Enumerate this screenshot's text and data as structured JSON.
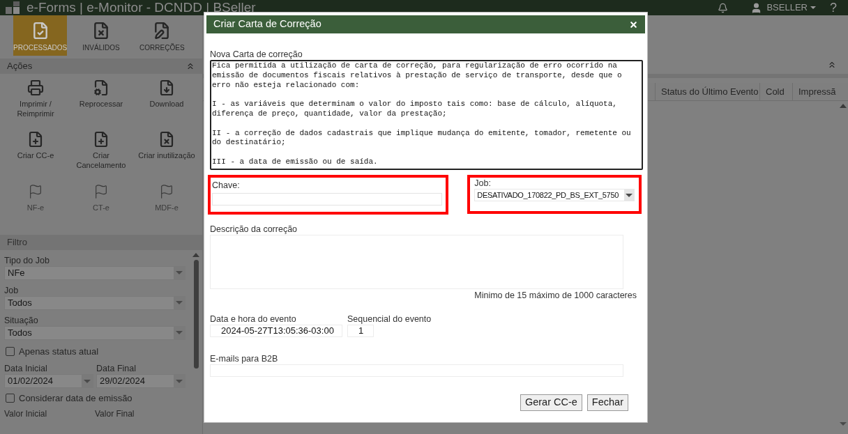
{
  "header": {
    "title": "e-Forms | e-Monitor - DCNDD | BSeller",
    "user": "BSELLER",
    "help": "?"
  },
  "tabs": [
    {
      "label": "PROCESSADOS",
      "kind": "processed",
      "selected": true
    },
    {
      "label": "INVÁLIDOS",
      "kind": "invalid",
      "selected": false
    },
    {
      "label": "CORREÇÕES",
      "kind": "correction",
      "selected": false
    }
  ],
  "actions": {
    "title": "Ações",
    "items": [
      {
        "label": "Imprimir / Reimprimir",
        "kind": "print"
      },
      {
        "label": "Reprocessar",
        "kind": "reprocess"
      },
      {
        "label": "Download",
        "kind": "download"
      },
      {
        "label": "Criar CC-e",
        "kind": "create"
      },
      {
        "label": "Criar Cancelamento",
        "kind": "create"
      },
      {
        "label": "Criar inutilização",
        "kind": "void"
      }
    ]
  },
  "doc_types": [
    "NF-e",
    "CT-e",
    "MDF-e"
  ],
  "filter": {
    "title": "Filtro",
    "selects": [
      {
        "label": "Tipo do Job",
        "value": "NFe"
      },
      {
        "label": "Job",
        "value": "Todos"
      },
      {
        "label": "Situação",
        "value": "Todos"
      }
    ],
    "current_status": {
      "label": "Apenas status atual",
      "checked": false
    },
    "dates": [
      {
        "label": "Data Inicial",
        "value": "01/02/2024"
      },
      {
        "label": "Data Final",
        "value": "29/02/2024"
      }
    ],
    "emission_date": {
      "label": "Considerar data de emissão",
      "checked": false
    },
    "values": [
      "Valor Inicial",
      "Valor Final"
    ]
  },
  "table": {
    "columns": [
      "Status do Último Evento",
      "Cold",
      "Impressã"
    ]
  },
  "modal": {
    "title": "Criar Carta de Correção",
    "letter_label": "Nova Carta de correção",
    "letter_text": "Fica permitida a utilização de carta de correção, para regularização de erro ocorrido na emissão de documentos fiscais relativos à prestação de serviço de transporte, desde que o erro não esteja relacionado com:\n\nI - as variáveis que determinam o valor do imposto tais como: base de cálculo, alíquota, diferença de preço, quantidade, valor da prestação;\n\nII - a correção de dados cadastrais que implique mudança do emitente, tomador, remetente ou do destinatário;\n\nIII - a data de emissão ou de saída.",
    "key_label": "Chave:",
    "job_label": "Job:",
    "job_value": "DESATIVADO_170822_PD_BS_EXT_5750",
    "description_label": "Descrição da correção",
    "description_hint": "Minimo de 15 máximo de 1000 caracteres",
    "event_date_label": "Data e hora do evento",
    "event_date_value": "2024-05-27T13:05:36-03:00",
    "sequence_label": "Sequencial do evento",
    "sequence_value": "1",
    "emails_label": "E-mails para B2B",
    "buttons": [
      "Gerar CC-e",
      "Fechar"
    ]
  }
}
